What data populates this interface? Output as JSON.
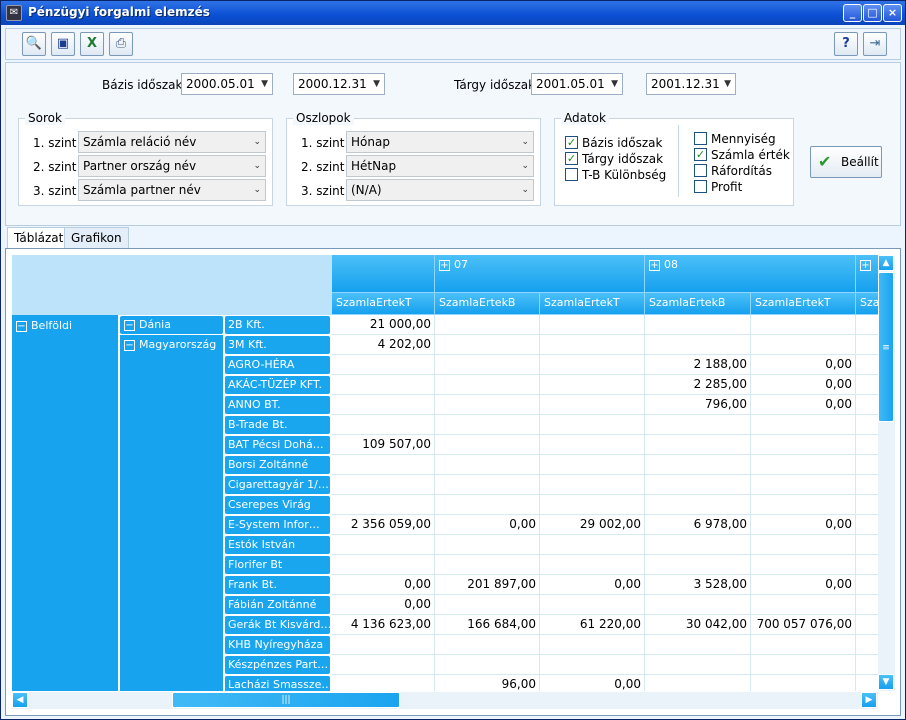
{
  "window": {
    "title": "Pénzügyi forgalmi elemzés",
    "app_icon": "app-icon",
    "buttons": [
      "minimize-icon",
      "maximize-icon",
      "close-icon"
    ]
  },
  "toolbar": {
    "left_tools": [
      "search-icon",
      "save-icon",
      "excel-icon",
      "print-icon"
    ],
    "right_tools": [
      "help-icon",
      "exit-icon"
    ]
  },
  "periods": {
    "base_label": "Bázis időszak",
    "base_from": "2000.05.01",
    "base_to": "2000.12.31",
    "target_label": "Tárgy időszak",
    "target_from": "2001.05.01",
    "target_to": "2001.12.31"
  },
  "rows_group": {
    "title": "Sorok",
    "levels": [
      {
        "label": "1. szint",
        "value": "Számla reláció név"
      },
      {
        "label": "2. szint",
        "value": "Partner ország név"
      },
      {
        "label": "3. szint",
        "value": "Számla partner név"
      }
    ]
  },
  "cols_group": {
    "title": "Oszlopok",
    "levels": [
      {
        "label": "1. szint",
        "value": "Hónap"
      },
      {
        "label": "2. szint",
        "value": "HétNap"
      },
      {
        "label": "3. szint",
        "value": "(N/A)"
      }
    ]
  },
  "data_group": {
    "title": "Adatok",
    "left": [
      {
        "label": "Bázis időszak",
        "checked": true
      },
      {
        "label": "Tárgy időszak",
        "checked": true
      },
      {
        "label": "T-B Különbség",
        "checked": false
      }
    ],
    "right": [
      {
        "label": "Mennyiség",
        "checked": false
      },
      {
        "label": "Számla érték",
        "checked": true
      },
      {
        "label": "Ráfordítás",
        "checked": false
      },
      {
        "label": "Profit",
        "checked": false
      }
    ]
  },
  "apply_label": "Beállít",
  "tabs": [
    "Táblázat",
    "Grafikon"
  ],
  "grid": {
    "groups": [
      {
        "label": "",
        "expand": ""
      },
      {
        "label": "07",
        "expand": "+"
      },
      {
        "label": "08",
        "expand": "+"
      },
      {
        "label": "",
        "expand": "+"
      }
    ],
    "columns": [
      "SzamlaErtekT",
      "SzamlaErtekB",
      "SzamlaErtekT",
      "SzamlaErtekB",
      "SzamlaErtekT",
      "Sza"
    ],
    "level1": [
      {
        "label": "Belföldi",
        "expand": "−"
      }
    ],
    "level2": [
      {
        "label": "Dánia",
        "expand": "−"
      },
      {
        "label": "Magyarország",
        "expand": "−"
      }
    ],
    "rows": [
      {
        "label": "2B Kft.",
        "cells": [
          "21 000,00",
          "",
          "",
          "",
          "",
          ""
        ]
      },
      {
        "label": "3M Kft.",
        "cells": [
          "4 202,00",
          "",
          "",
          "",
          "",
          ""
        ]
      },
      {
        "label": "AGRO-HÉRA",
        "cells": [
          "",
          "",
          "",
          "2 188,00",
          "0,00",
          ""
        ]
      },
      {
        "label": "AKÁC-TÜZÉP KFT.",
        "cells": [
          "",
          "",
          "",
          "2 285,00",
          "0,00",
          ""
        ]
      },
      {
        "label": "ANNO BT.",
        "cells": [
          "",
          "",
          "",
          "796,00",
          "0,00",
          ""
        ]
      },
      {
        "label": "B-Trade Bt.",
        "cells": [
          "",
          "",
          "",
          "",
          "",
          ""
        ]
      },
      {
        "label": "BAT Pécsi Dohá…",
        "cells": [
          "109 507,00",
          "",
          "",
          "",
          "",
          ""
        ]
      },
      {
        "label": "Borsi Zoltánné",
        "cells": [
          "",
          "",
          "",
          "",
          "",
          ""
        ]
      },
      {
        "label": "Cigarettagyár 1/…",
        "cells": [
          "",
          "",
          "",
          "",
          "",
          ""
        ]
      },
      {
        "label": "Cserepes Virág",
        "cells": [
          "",
          "",
          "",
          "",
          "",
          ""
        ]
      },
      {
        "label": "E-System Infor…",
        "cells": [
          "2 356 059,00",
          "0,00",
          "29 002,00",
          "6 978,00",
          "0,00",
          ""
        ]
      },
      {
        "label": "Estók István",
        "cells": [
          "",
          "",
          "",
          "",
          "",
          ""
        ]
      },
      {
        "label": "Florifer Bt",
        "cells": [
          "",
          "",
          "",
          "",
          "",
          ""
        ]
      },
      {
        "label": "Frank Bt.",
        "cells": [
          "0,00",
          "201 897,00",
          "0,00",
          "3 528,00",
          "0,00",
          ""
        ]
      },
      {
        "label": "Fábián Zoltánné",
        "cells": [
          "0,00",
          "",
          "",
          "",
          "",
          ""
        ]
      },
      {
        "label": "Gerák Bt Kisvárd…",
        "cells": [
          "4 136 623,00",
          "166 684,00",
          "61 220,00",
          "30 042,00",
          "700 057 076,00",
          ""
        ]
      },
      {
        "label": "KHB Nyíregyháza",
        "cells": [
          "",
          "",
          "",
          "",
          "",
          ""
        ]
      },
      {
        "label": "Készpénzes Part…",
        "cells": [
          "",
          "",
          "",
          "",
          "",
          ""
        ]
      },
      {
        "label": "Lacházi Smassze…",
        "cells": [
          "",
          "96,00",
          "0,00",
          "",
          "",
          ""
        ]
      }
    ]
  }
}
